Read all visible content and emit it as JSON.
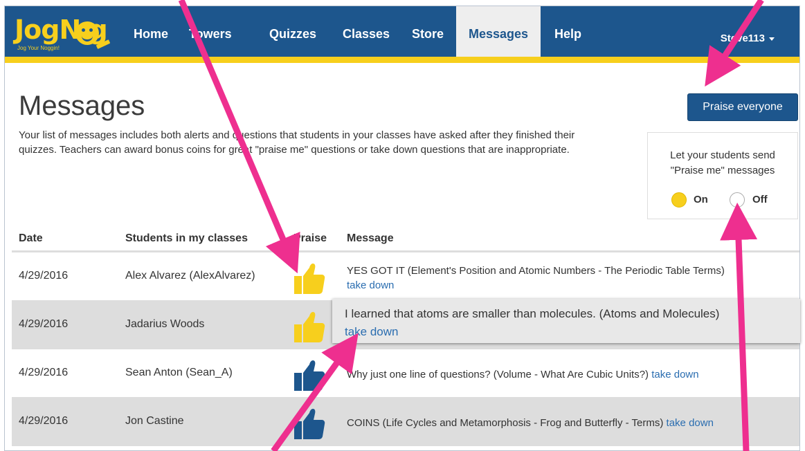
{
  "nav": {
    "logo_text": "JogN  g",
    "logo_tagline": "Jog Your Noggin!",
    "items": [
      {
        "label": "Home"
      },
      {
        "label": "Towers"
      },
      {
        "label": "Quizzes"
      },
      {
        "label": "Classes"
      },
      {
        "label": "Store"
      },
      {
        "label": "Messages"
      },
      {
        "label": "Help"
      }
    ],
    "active": "Messages",
    "user": "Steve113"
  },
  "page": {
    "title": "Messages",
    "intro": "Your list of messages includes both alerts and questions that students in your classes have asked after they finished their quizzes. Teachers can award bonus coins for great \"praise me\" questions or take down questions that are inappropriate."
  },
  "praise": {
    "button_label": "Praise everyone",
    "box_line1": "Let your students send",
    "box_line2": "\"Praise me\" messages",
    "on_label": "On",
    "off_label": "Off",
    "selected": "On"
  },
  "table": {
    "headers": [
      "Date",
      "Students in my classes",
      "Praise",
      "Message"
    ],
    "take_down_label": "take down",
    "rows": [
      {
        "date": "4/29/2016",
        "student": "Alex Alvarez (AlexAlvarez)",
        "praised": true,
        "message": "YES GOT IT (Element's Position and Atomic Numbers - The Periodic Table Terms)"
      },
      {
        "date": "4/29/2016",
        "student": "Jadarius Woods",
        "praised": true,
        "message": "I learned that atoms are smaller than molecules. (Atoms and Molecules)"
      },
      {
        "date": "4/29/2016",
        "student": "Sean Anton (Sean_A)",
        "praised": false,
        "message": "Why just one line of questions? (Volume - What Are Cubic Units?)"
      },
      {
        "date": "4/29/2016",
        "student": "Jon Castine",
        "praised": false,
        "message": "COINS (Life Cycles and Metamorphosis - Frog and Butterfly - Terms)"
      }
    ]
  },
  "colors": {
    "nav_blue": "#1d568d",
    "accent_yellow": "#f7cf1d",
    "link_blue": "#2a6db0",
    "annotation_pink": "#ee2f8f"
  }
}
